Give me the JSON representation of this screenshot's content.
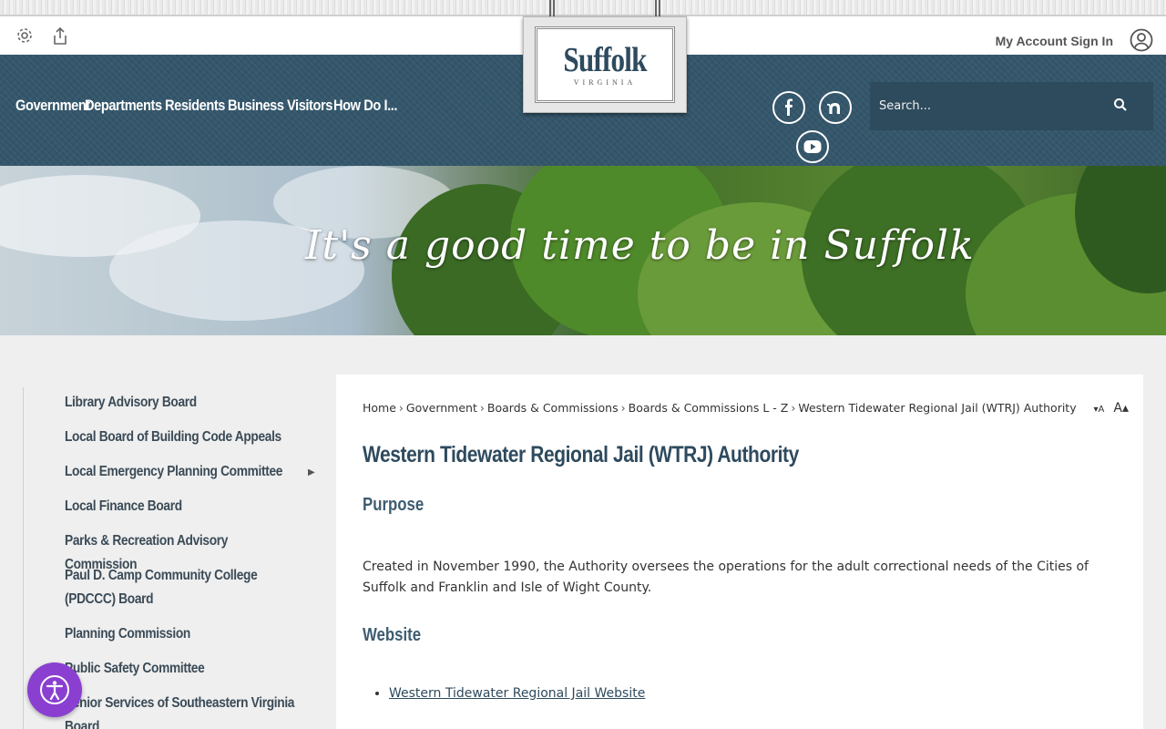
{
  "util": {
    "signin_label": "My Account Sign In"
  },
  "logo": {
    "name": "Suffolk",
    "sub": "VIRGINIA"
  },
  "nav": {
    "items": [
      "Government",
      "Departments",
      "Residents",
      "Business",
      "Visitors",
      "How Do I..."
    ]
  },
  "social": {
    "icons": [
      "facebook-icon",
      "nextdoor-icon",
      "youtube-icon"
    ]
  },
  "search": {
    "placeholder": "Search..."
  },
  "banner": {
    "tagline": "It's a good time to be in Suffolk"
  },
  "sidebar": {
    "items": [
      "Library Advisory Board",
      "Local Board of Building Code Appeals",
      "Local Emergency Planning Committee",
      "Local Finance Board",
      "Parks & Recreation Advisory Commission",
      "Paul D. Camp Community College (PDCCC) Board",
      "Planning Commission",
      "Public Safety Committee",
      "Senior Services of Southeastern Virginia Board"
    ],
    "expand_arrow": "▶"
  },
  "breadcrumb": {
    "items": [
      "Home",
      "Government",
      "Boards & Commissions",
      "Boards & Commissions L - Z",
      "Western Tidewater Regional Jail (WTRJ) Authority"
    ]
  },
  "resize": {
    "smaller": "▾A",
    "larger": "A▴"
  },
  "main": {
    "title": "Western Tidewater Regional Jail (WTRJ) Authority",
    "purpose_heading": "Purpose",
    "purpose_text": "Created in November 1990, the Authority oversees the operations for the adult correctional needs of the Cities of Suffolk and Franklin and Isle of Wight County.",
    "website_heading": "Website",
    "website_link": "Western Tidewater Regional Jail Website"
  },
  "colors": {
    "header": "#34566b",
    "title": "#2e4a5e",
    "accessibility": "#8a3fd1"
  }
}
